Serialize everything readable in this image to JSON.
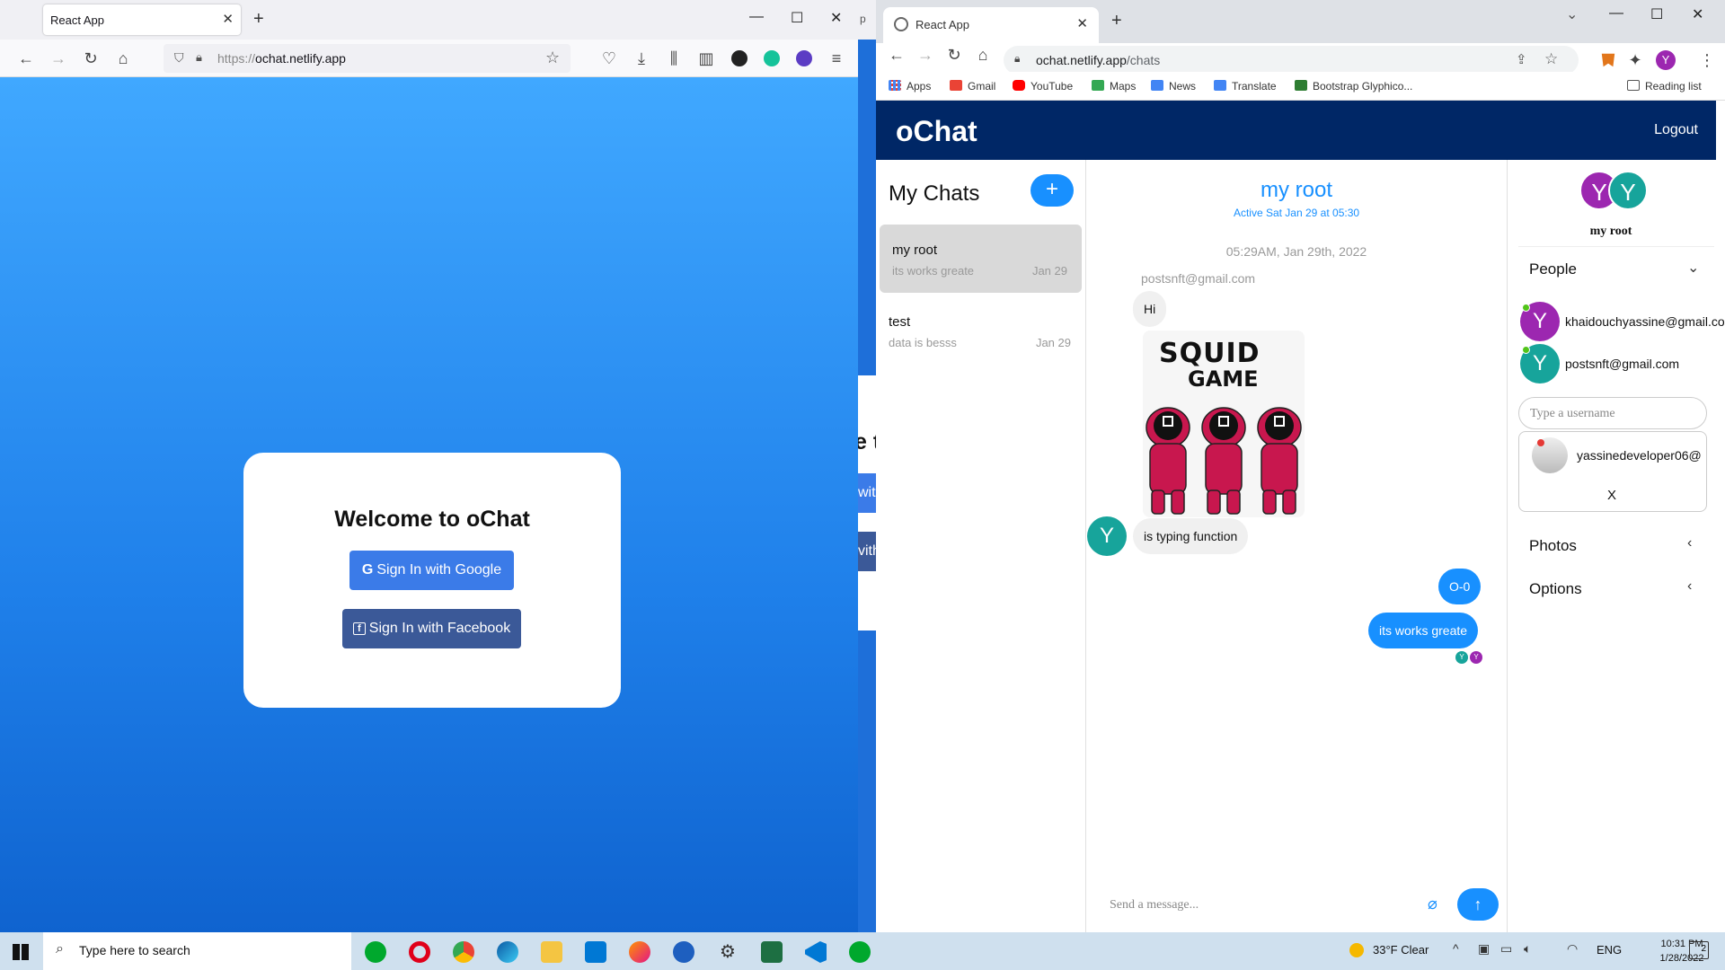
{
  "firefox": {
    "tab_title": "React App",
    "url_prefix": "https://",
    "url_domain": "ochat.netlify.app",
    "welcome_title": "Welcome to oChat",
    "google_btn": "Sign In with Google",
    "facebook_btn": "Sign In with Facebook"
  },
  "behind_window": {
    "tab_fragment": "p",
    "title_fragment": "e t",
    "btn1_fragment": "wit",
    "btn2_fragment": "vith"
  },
  "chrome": {
    "tab_title": "React App",
    "url_domain": "ochat.netlify.app",
    "url_path": "/chats",
    "profile_initial": "Y",
    "bookmarks": [
      {
        "label": "Apps",
        "color": "#4285f4"
      },
      {
        "label": "Gmail",
        "color": "#ea4335"
      },
      {
        "label": "YouTube",
        "color": "#ff0000"
      },
      {
        "label": "Maps",
        "color": "#34a853"
      },
      {
        "label": "News",
        "color": "#4285f4"
      },
      {
        "label": "Translate",
        "color": "#4285f4"
      },
      {
        "label": "Bootstrap Glyphico...",
        "color": "#2e7d32"
      }
    ],
    "reading_list": "Reading list"
  },
  "app": {
    "logo": "oChat",
    "logout": "Logout",
    "my_chats_title": "My Chats",
    "new_chat_symbol": "+",
    "chats": [
      {
        "title": "my root",
        "last_message": "its works greate",
        "date": "Jan 29"
      },
      {
        "title": "test",
        "last_message": "data is besss",
        "date": "Jan 29"
      }
    ],
    "feed": {
      "title": "my root",
      "subtitle": "Active Sat Jan 29 at 05:30",
      "timestamp": "05:29AM, Jan 29th, 2022",
      "sender": "postsnft@gmail.com",
      "msg_hi": "Hi",
      "image_text_1": "SQUID",
      "image_text_2": "GAME",
      "msg_typing": "is typing function",
      "typing_avatar": "Y",
      "msg_mine_1": "O-0",
      "msg_mine_2": "its works greate",
      "read_1": "Y",
      "read_2": "Y",
      "input_placeholder": "Send a message...",
      "send_symbol": "↑"
    },
    "settings": {
      "avatar_1": "Y",
      "avatar_2": "Y",
      "chat_name": "my root",
      "people_label": "People",
      "people": [
        {
          "initial": "Y",
          "email": "khaidouchyassine@gmail.com",
          "color": "#9c27b0"
        },
        {
          "initial": "Y",
          "email": "postsnft@gmail.com",
          "color": "#17a49b"
        }
      ],
      "username_placeholder": "Type a username",
      "search_result": "yassinedeveloper06@",
      "close_symbol": "X",
      "photos_label": "Photos",
      "options_label": "Options"
    }
  },
  "taskbar": {
    "search_placeholder": "Type here to search",
    "weather_temp": "33°F",
    "weather_cond": "Clear",
    "lang": "ENG",
    "time": "10:31 PM",
    "date": "1/28/2022",
    "notif_count": "2"
  },
  "colors": {
    "brand_blue": "#1890ff",
    "header_navy": "#002766",
    "purple_avatar": "#9c27b0",
    "teal_avatar": "#17a49b"
  }
}
